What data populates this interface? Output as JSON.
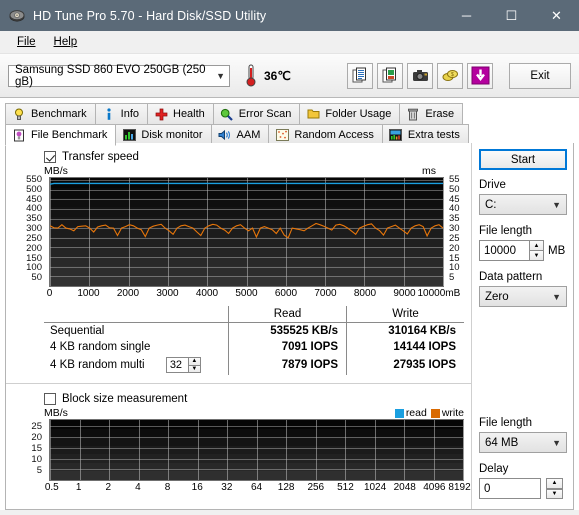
{
  "window": {
    "title": "HD Tune Pro 5.70 - Hard Disk/SSD Utility",
    "icon": "hard-disk-icon",
    "minimize": "─",
    "maximize": "☐",
    "close": "✕",
    "titlebar_color": "#5b6a78"
  },
  "menu": {
    "items": [
      "File",
      "Help"
    ]
  },
  "toolbar": {
    "drive": "Samsung SSD 860 EVO 250GB (250 gB)",
    "temperature": "36℃",
    "icons": [
      "copy-text-icon",
      "copy-image-icon",
      "camera-icon",
      "coins-icon",
      "download-icon"
    ],
    "exit_label": "Exit"
  },
  "tabs": {
    "row1": [
      {
        "label": "Benchmark",
        "icon": "lightbulb-icon",
        "active": false
      },
      {
        "label": "Info",
        "icon": "info-icon",
        "active": false
      },
      {
        "label": "Health",
        "icon": "red-cross-icon",
        "active": false
      },
      {
        "label": "Error Scan",
        "icon": "magnifier-icon",
        "active": false
      },
      {
        "label": "Folder Usage",
        "icon": "folder-icon",
        "active": false
      },
      {
        "label": "Erase",
        "icon": "trash-icon",
        "active": false
      }
    ],
    "row2": [
      {
        "label": "File Benchmark",
        "icon": "file-benchmark-icon",
        "active": true
      },
      {
        "label": "Disk monitor",
        "icon": "bar-chart-icon",
        "active": false
      },
      {
        "label": "AAM",
        "icon": "speaker-icon",
        "active": false
      },
      {
        "label": "Random Access",
        "icon": "random-access-icon",
        "active": false
      },
      {
        "label": "Extra tests",
        "icon": "extra-tests-icon",
        "active": false
      }
    ]
  },
  "transfer_speed": {
    "checkbox_label": "Transfer speed",
    "checked": true
  },
  "block_size": {
    "checkbox_label": "Block size measurement",
    "checked": false
  },
  "legend": {
    "read_label": "read",
    "write_label": "write",
    "read_color": "#1a9fe0",
    "write_color": "#d96a02"
  },
  "results": {
    "columns": [
      "",
      "Read",
      "Write"
    ],
    "rows": [
      {
        "name": "Sequential",
        "read": "535525 KB/s",
        "write": "310164 KB/s",
        "spinner": null
      },
      {
        "name": "4 KB random single",
        "read": "7091 IOPS",
        "write": "14144 IOPS",
        "spinner": null
      },
      {
        "name": "4 KB random multi",
        "read": "7879 IOPS",
        "write": "27935 IOPS",
        "spinner": "32"
      }
    ]
  },
  "right_panel": {
    "start_label": "Start",
    "drive_label": "Drive",
    "drive_value": "C:",
    "file_length_label": "File length",
    "file_length_value": "10000",
    "file_length_unit": "MB",
    "data_pattern_label": "Data pattern",
    "data_pattern_value": "Zero",
    "block_file_length_label": "File length",
    "block_file_length_value": "64 MB",
    "delay_label": "Delay",
    "delay_value": "0"
  },
  "chart_data": [
    {
      "type": "line",
      "title": "",
      "ylabel": "MB/s",
      "y2label": "ms",
      "xlabel": "mB",
      "x_unit_suffix": "mB",
      "categories": [],
      "xticks": [
        0,
        1000,
        2000,
        3000,
        4000,
        5000,
        6000,
        7000,
        8000,
        9000,
        10000
      ],
      "xlim": [
        0,
        10000
      ],
      "yticks": [
        50,
        100,
        150,
        200,
        250,
        300,
        350,
        400,
        450,
        500,
        550
      ],
      "ylim": [
        0,
        560
      ],
      "y2ticks": [
        5,
        10,
        15,
        20,
        25,
        30,
        35,
        40,
        45,
        50,
        55
      ],
      "y2lim": [
        0,
        56
      ],
      "grid": true,
      "background": "#000000",
      "series": [
        {
          "name": "read",
          "color": "#1a9fe0",
          "axis": "left",
          "values": [
            528,
            532,
            532,
            532,
            532,
            532,
            532,
            532,
            532,
            532,
            532,
            532,
            532,
            532,
            532,
            532,
            532,
            532,
            532,
            532,
            532,
            532,
            532,
            532,
            532,
            532,
            532,
            532,
            532,
            532,
            532,
            532,
            532,
            532,
            532,
            532,
            532,
            532,
            532,
            532,
            532,
            532,
            532,
            532,
            532,
            532,
            532,
            532,
            532,
            532,
            532,
            532,
            532,
            532,
            532,
            532,
            532,
            532,
            532,
            532,
            532,
            532,
            532,
            532,
            532,
            532,
            532,
            532,
            532,
            532,
            532,
            532,
            532,
            532,
            532,
            532,
            532,
            532,
            532,
            532,
            532,
            532,
            532,
            532,
            532,
            532,
            532,
            532,
            532,
            532,
            532,
            532,
            532,
            532,
            532,
            532,
            532,
            532,
            532,
            532
          ]
        },
        {
          "name": "write",
          "color": "#e8760a",
          "axis": "left",
          "values": [
            312,
            302,
            300,
            318,
            300,
            296,
            286,
            308,
            310,
            312,
            300,
            280,
            306,
            312,
            316,
            302,
            300,
            262,
            300,
            308,
            318,
            312,
            300,
            292,
            256,
            300,
            310,
            316,
            320,
            300,
            286,
            268,
            300,
            312,
            316,
            308,
            300,
            280,
            262,
            300,
            312,
            320,
            316,
            300,
            290,
            272,
            300,
            312,
            318,
            300,
            286,
            300,
            254,
            300,
            308,
            300,
            292,
            272,
            300,
            264,
            250,
            300,
            296,
            292,
            286,
            300,
            312,
            324,
            318,
            310,
            300,
            290,
            316,
            320,
            312,
            300,
            284,
            268,
            300,
            310,
            318,
            322,
            300,
            288,
            264,
            300,
            308,
            316,
            300,
            286,
            270,
            300,
            312,
            318,
            308,
            260,
            300,
            312,
            318,
            300
          ]
        }
      ]
    },
    {
      "type": "line",
      "title": "",
      "ylabel": "MB/s",
      "xlabel": "",
      "xticks": [
        "0.5",
        "1",
        "2",
        "4",
        "8",
        "16",
        "32",
        "64",
        "128",
        "256",
        "512",
        "1024",
        "2048",
        "4096",
        "8192"
      ],
      "yticks": [
        5,
        10,
        15,
        20,
        25
      ],
      "ylim": [
        0,
        28
      ],
      "grid": true,
      "background": "#000000",
      "series": [
        {
          "name": "read",
          "color": "#1a9fe0",
          "values": []
        },
        {
          "name": "write",
          "color": "#e8760a",
          "values": []
        }
      ]
    }
  ]
}
